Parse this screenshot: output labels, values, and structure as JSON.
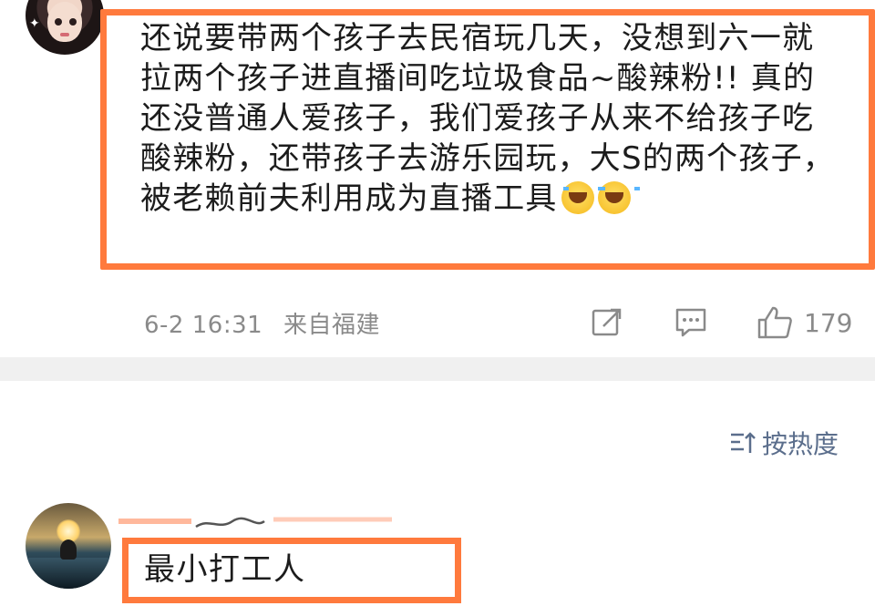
{
  "post": {
    "text": "还说要带两个孩子去民宿玩几天，没想到六一就拉两个孩子进直播间吃垃圾食品~酸辣粉!! 真的还没普通人爱孩子，我们爱孩子从来不给孩子吃酸辣粉，还带孩子去游乐园玩，大S的两个孩子，被老赖前夫利用成为直播工具",
    "emojis": [
      "crying-laughing-emoji",
      "crying-laughing-emoji"
    ],
    "date": "6-2 16:31",
    "location": "来自福建",
    "like_count": "179"
  },
  "sort": {
    "label": "按热度"
  },
  "reply": {
    "text": "最小打工人"
  },
  "colors": {
    "highlight": "#ff7a3d",
    "meta": "#8a8a8a",
    "sort": "#5b6e8c"
  }
}
